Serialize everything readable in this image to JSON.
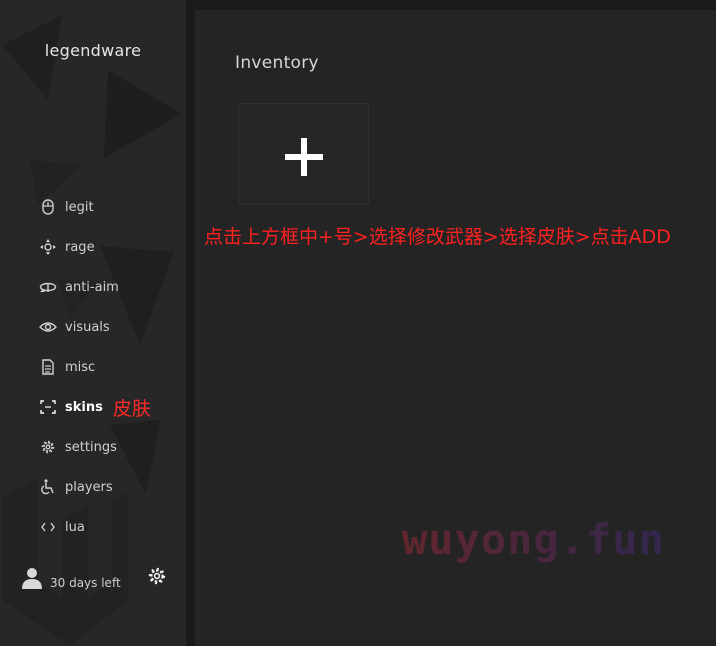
{
  "app": {
    "brand": "legendware"
  },
  "sidebar": {
    "items": [
      {
        "id": "legit",
        "label": "legit",
        "icon": "mouse-icon"
      },
      {
        "id": "rage",
        "label": "rage",
        "icon": "crosshair-icon"
      },
      {
        "id": "anti-aim",
        "label": "anti-aim",
        "icon": "rotate-icon"
      },
      {
        "id": "visuals",
        "label": "visuals",
        "icon": "eye-icon"
      },
      {
        "id": "misc",
        "label": "misc",
        "icon": "document-icon"
      },
      {
        "id": "skins",
        "label": "skins",
        "icon": "frame-corners-icon",
        "active": true,
        "note": "皮肤"
      },
      {
        "id": "settings",
        "label": "settings",
        "icon": "gear-icon"
      },
      {
        "id": "players",
        "label": "players",
        "icon": "wheelchair-icon"
      },
      {
        "id": "lua",
        "label": "lua",
        "icon": "code-brackets-icon"
      }
    ]
  },
  "footer": {
    "subscription": "30 days left"
  },
  "main": {
    "title": "Inventory",
    "add_tile_icon": "plus-icon",
    "instruction": "点击上方框中+号>选择修改武器>选择皮肤>点击ADD",
    "watermark": "wuyong.fun"
  },
  "colors": {
    "sidebar_bg": "#272727",
    "panel_bg": "#242424",
    "annotation": "#ff2020"
  }
}
